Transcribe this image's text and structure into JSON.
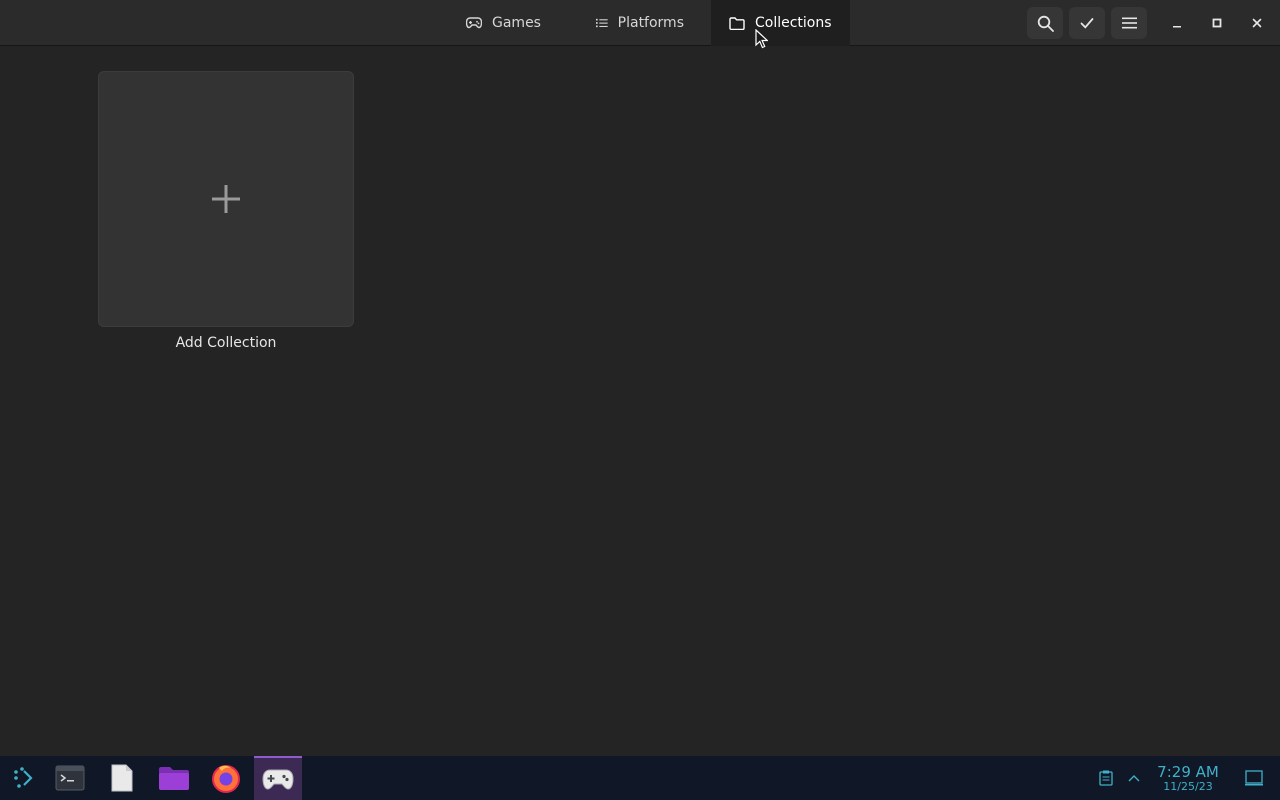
{
  "header": {
    "tabs": [
      {
        "label": "Games",
        "icon": "gamepad-icon"
      },
      {
        "label": "Platforms",
        "icon": "list-icon"
      },
      {
        "label": "Collections",
        "icon": "folder-icon",
        "active": true
      }
    ],
    "buttons": [
      "search-icon",
      "check-icon",
      "hamburger-menu-icon"
    ],
    "window_controls": [
      "minimize-icon",
      "maximize-icon",
      "close-icon"
    ]
  },
  "main": {
    "add_collection_label": "Add Collection"
  },
  "taskbar": {
    "apps": [
      "app-launcher",
      "konsole",
      "text-editor",
      "file-manager",
      "firefox",
      "game-launcher"
    ],
    "clock": {
      "time": "7:29 AM",
      "date": "11/25/23"
    },
    "accent": "#3fb0c8"
  }
}
